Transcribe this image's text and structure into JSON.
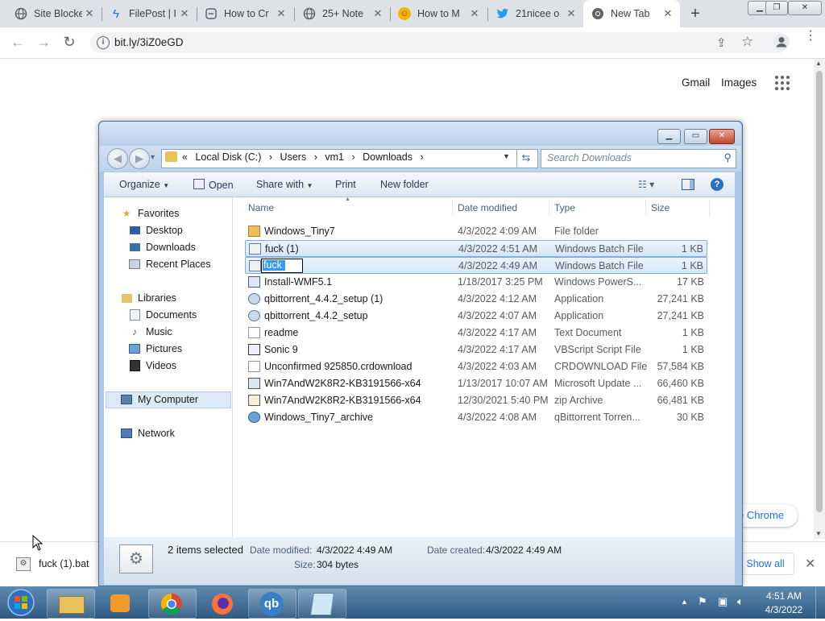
{
  "browser": {
    "tabs": [
      {
        "title": "Site Blocke",
        "icon": "globe-icon"
      },
      {
        "title": "FilePost | I",
        "icon": "bolt-icon"
      },
      {
        "title": "How to Cr",
        "icon": "page-icon"
      },
      {
        "title": "25+ Note",
        "icon": "globe-icon"
      },
      {
        "title": "How to M",
        "icon": "face-icon"
      },
      {
        "title": "21nicee o",
        "icon": "twitter-icon"
      },
      {
        "title": "New Tab",
        "icon": "chrome-icon"
      }
    ],
    "url": "bit.ly/3iZ0eGD",
    "new_tab_symbol": "+",
    "page": {
      "gmail": "Gmail",
      "images": "Images",
      "customize_button": "e Chrome"
    }
  },
  "download_bar": {
    "filename": "fuck (1).bat",
    "show_all": "Show all"
  },
  "explorer": {
    "breadcrumb": [
      "Local Disk (C:)",
      "Users",
      "vm1",
      "Downloads"
    ],
    "breadcrumb_prefix": "«",
    "search_placeholder": "Search Downloads",
    "commands": {
      "organize": "Organize",
      "open": "Open",
      "share_with": "Share with",
      "print": "Print",
      "new_folder": "New folder"
    },
    "nav": {
      "favorites": "Favorites",
      "desktop": "Desktop",
      "downloads": "Downloads",
      "recent_places": "Recent Places",
      "libraries": "Libraries",
      "documents": "Documents",
      "music": "Music",
      "pictures": "Pictures",
      "videos": "Videos",
      "my_computer": "My Computer",
      "network": "Network"
    },
    "columns": {
      "name": "Name",
      "date": "Date modified",
      "type": "Type",
      "size": "Size"
    },
    "files": [
      {
        "name": "Windows_Tiny7",
        "date": "4/3/2022 4:09 AM",
        "type": "File folder",
        "size": "",
        "icon": "folder-icon",
        "selected": false
      },
      {
        "name": "fuck (1)",
        "date": "4/3/2022 4:51 AM",
        "type": "Windows Batch File",
        "size": "1 KB",
        "icon": "batch-file-icon",
        "selected": true
      },
      {
        "name": "fuck",
        "date": "4/3/2022 4:49 AM",
        "type": "Windows Batch File",
        "size": "1 KB",
        "icon": "batch-file-icon",
        "selected": true
      },
      {
        "name": "Install-WMF5.1",
        "date": "1/18/2017 3:25 PM",
        "type": "Windows PowerS...",
        "size": "17 KB",
        "icon": "powershell-icon",
        "selected": false
      },
      {
        "name": "qbittorrent_4.4.2_setup (1)",
        "date": "4/3/2022 4:12 AM",
        "type": "Application",
        "size": "27,241 KB",
        "icon": "installer-icon",
        "selected": false
      },
      {
        "name": "qbittorrent_4.4.2_setup",
        "date": "4/3/2022 4:07 AM",
        "type": "Application",
        "size": "27,241 KB",
        "icon": "installer-icon",
        "selected": false
      },
      {
        "name": "readme",
        "date": "4/3/2022 4:17 AM",
        "type": "Text Document",
        "size": "1 KB",
        "icon": "text-file-icon",
        "selected": false
      },
      {
        "name": "Sonic 9",
        "date": "4/3/2022 4:17 AM",
        "type": "VBScript Script File",
        "size": "1 KB",
        "icon": "script-icon",
        "selected": false
      },
      {
        "name": "Unconfirmed 925850.crdownload",
        "date": "4/3/2022 4:03 AM",
        "type": "CRDOWNLOAD File",
        "size": "57,584 KB",
        "icon": "file-icon",
        "selected": false
      },
      {
        "name": "Win7AndW2K8R2-KB3191566-x64",
        "date": "1/13/2017 10:07 AM",
        "type": "Microsoft Update ...",
        "size": "66,460 KB",
        "icon": "update-icon",
        "selected": false
      },
      {
        "name": "Win7AndW2K8R2-KB3191566-x64",
        "date": "12/30/2021 5:40 PM",
        "type": "zip Archive",
        "size": "66,481 KB",
        "icon": "zip-icon",
        "selected": false
      },
      {
        "name": "Windows_Tiny7_archive",
        "date": "4/3/2022 4:08 AM",
        "type": "qBittorrent Torren...",
        "size": "30 KB",
        "icon": "torrent-icon",
        "selected": false
      }
    ],
    "rename_text": "fuck",
    "status": {
      "selected_count": "2 items selected",
      "date_modified_label": "Date modified:",
      "date_modified": "4/3/2022 4:49 AM",
      "date_created_label": "Date created:",
      "date_created": "4/3/2022 4:49 AM",
      "size_label": "Size:",
      "size": "304 bytes"
    }
  },
  "taskbar": {
    "time": "4:51 AM",
    "date": "4/3/2022",
    "apps": [
      "explorer-icon",
      "media-player-icon",
      "chrome-icon",
      "firefox-icon",
      "qbittorrent-icon",
      "notepad-icon"
    ]
  },
  "colors": {
    "accent": "#1a73e8",
    "taskbar": "#3d6a94",
    "selection": "#3399ff"
  }
}
